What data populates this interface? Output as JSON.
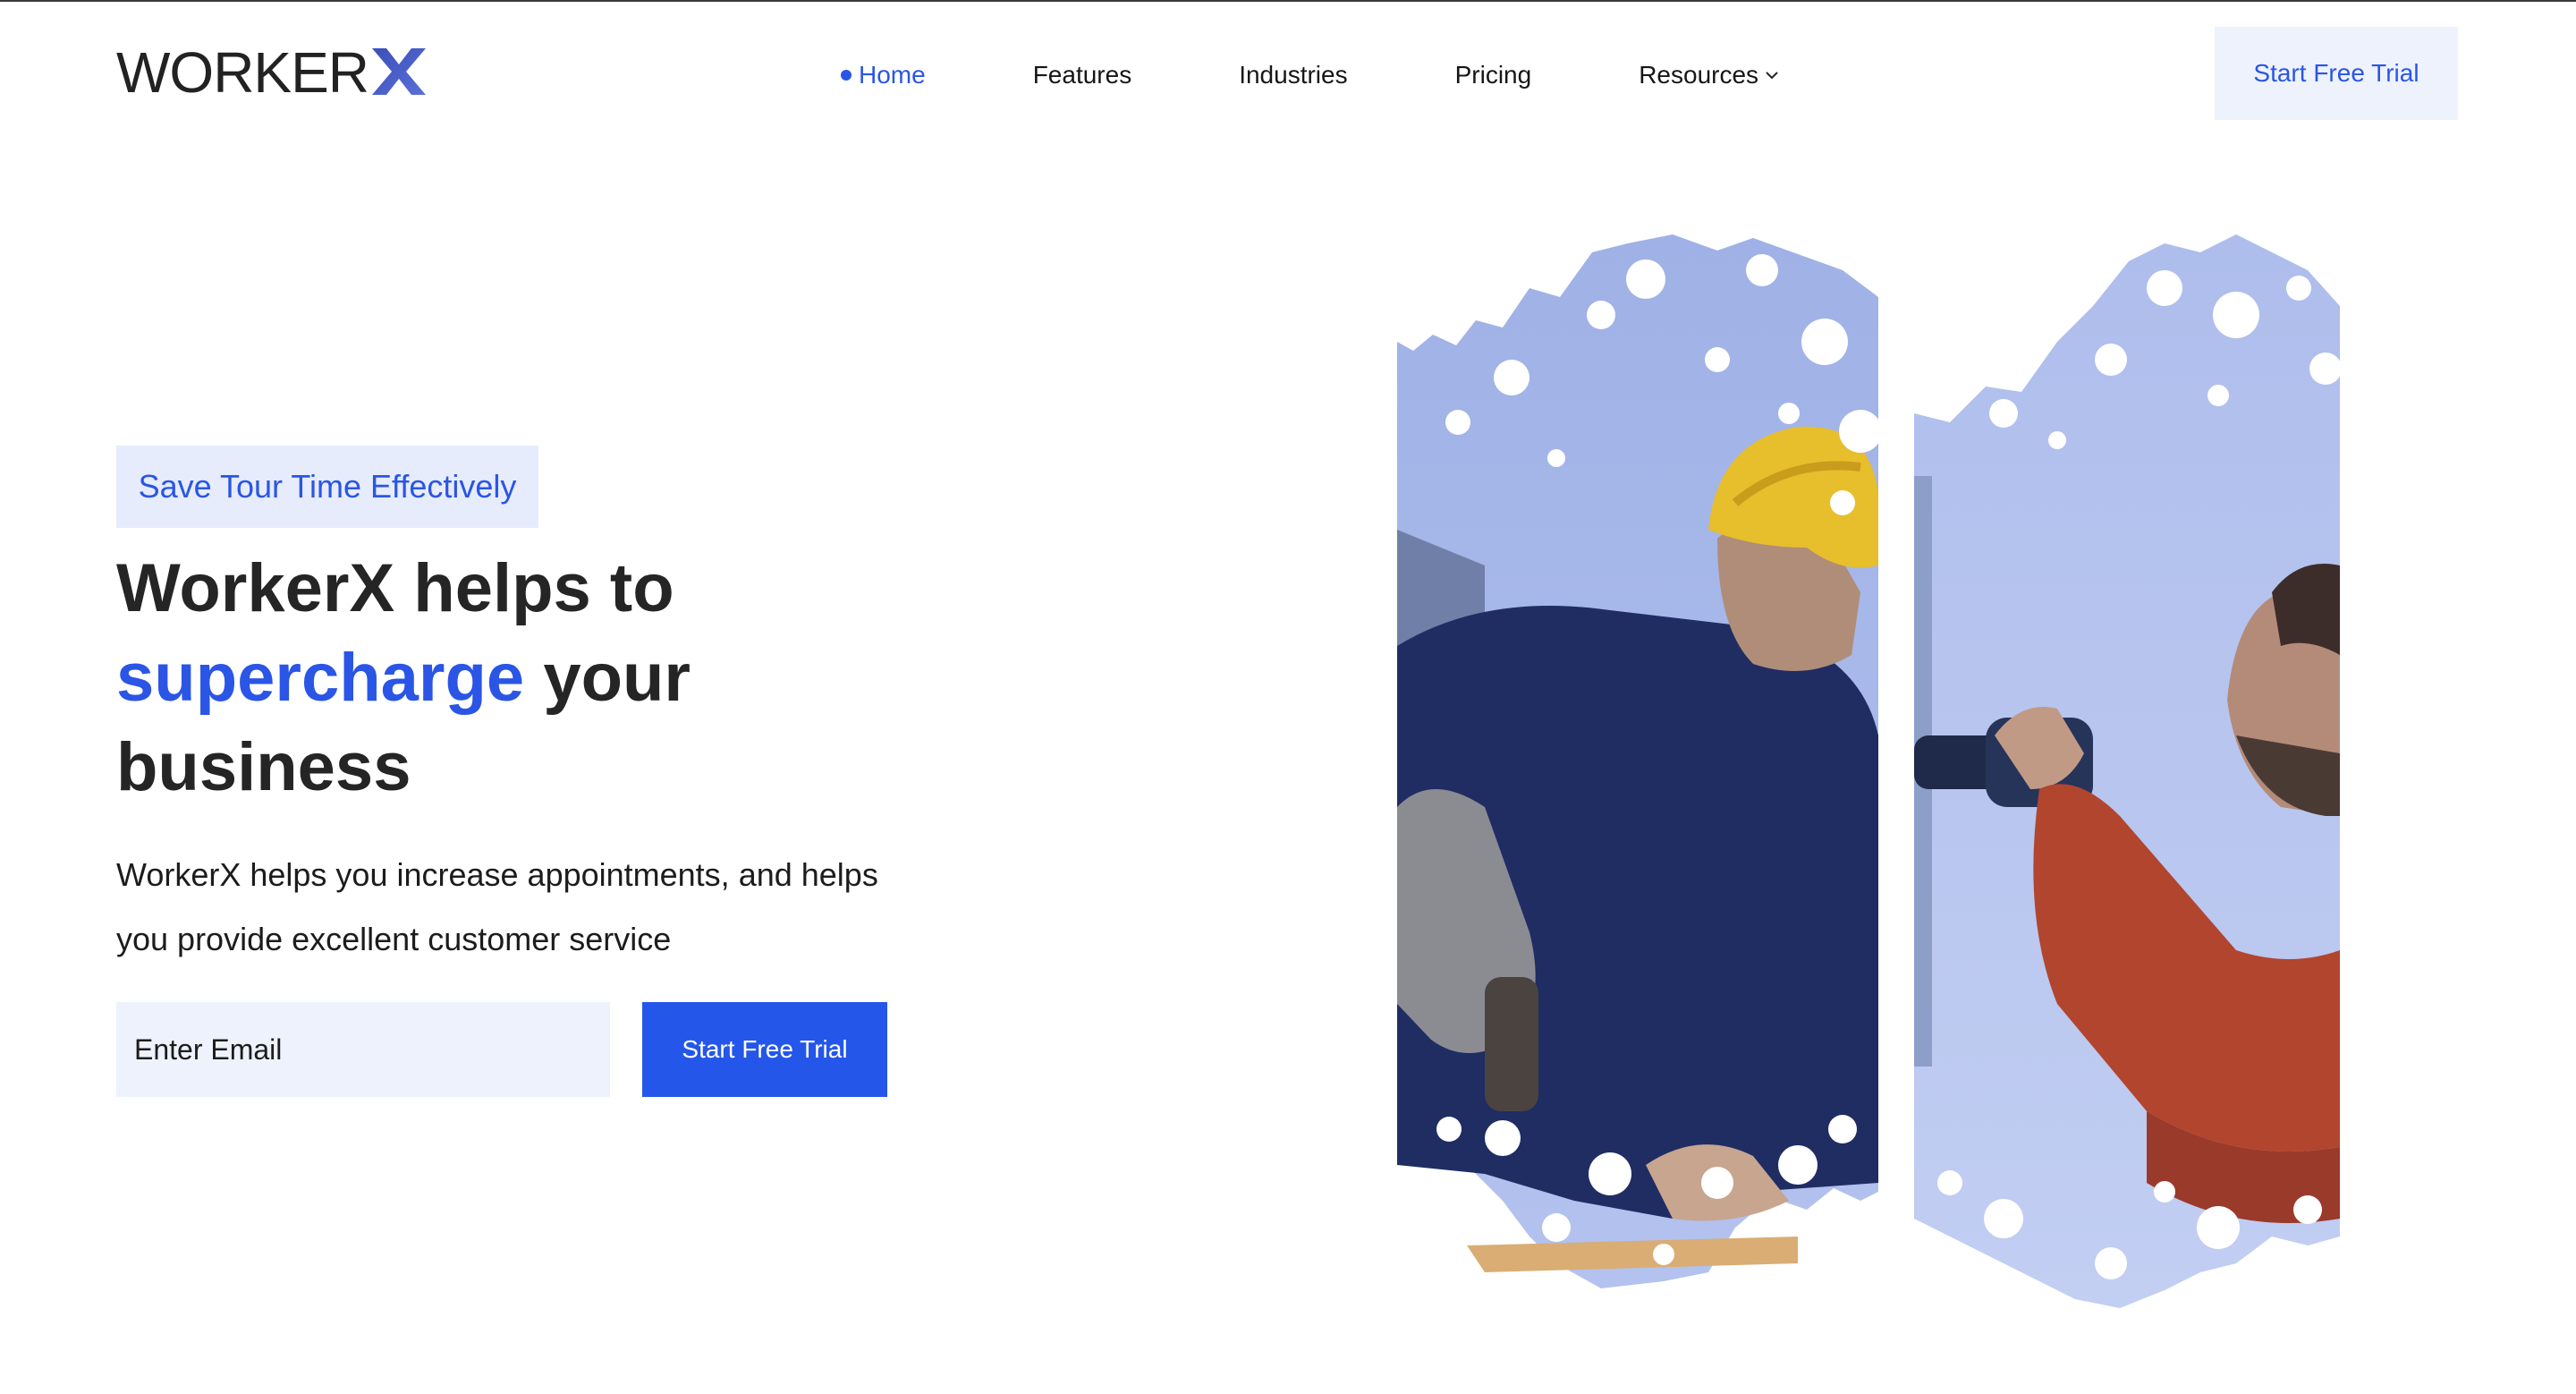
{
  "header": {
    "logo_text": "WORKER",
    "logo_mark": "X",
    "nav": [
      {
        "label": "Home",
        "active": true
      },
      {
        "label": "Features",
        "active": false
      },
      {
        "label": "Industries",
        "active": false
      },
      {
        "label": "Pricing",
        "active": false
      },
      {
        "label": "Resources",
        "active": false,
        "dropdown": true
      }
    ],
    "cta_label": "Start Free Trial"
  },
  "hero": {
    "badge": "Save Tour Time Effectively",
    "headline_part1": "WorkerX helps to",
    "headline_accent": "supercharge",
    "headline_part2": "your",
    "headline_part3": "business",
    "subtext": "WorkerX helps you increase appointments, and helps you provide excellent customer service",
    "email_placeholder": "Enter Email",
    "cta_label": "Start Free Trial"
  },
  "colors": {
    "accent": "#2456ea",
    "badge_bg": "#e6ecfc",
    "input_bg": "#eef2fd",
    "image_tint": "#9fb2e6"
  },
  "icons": [
    "x-logo-icon",
    "nav-active-dot-icon",
    "chevron-down-icon"
  ]
}
